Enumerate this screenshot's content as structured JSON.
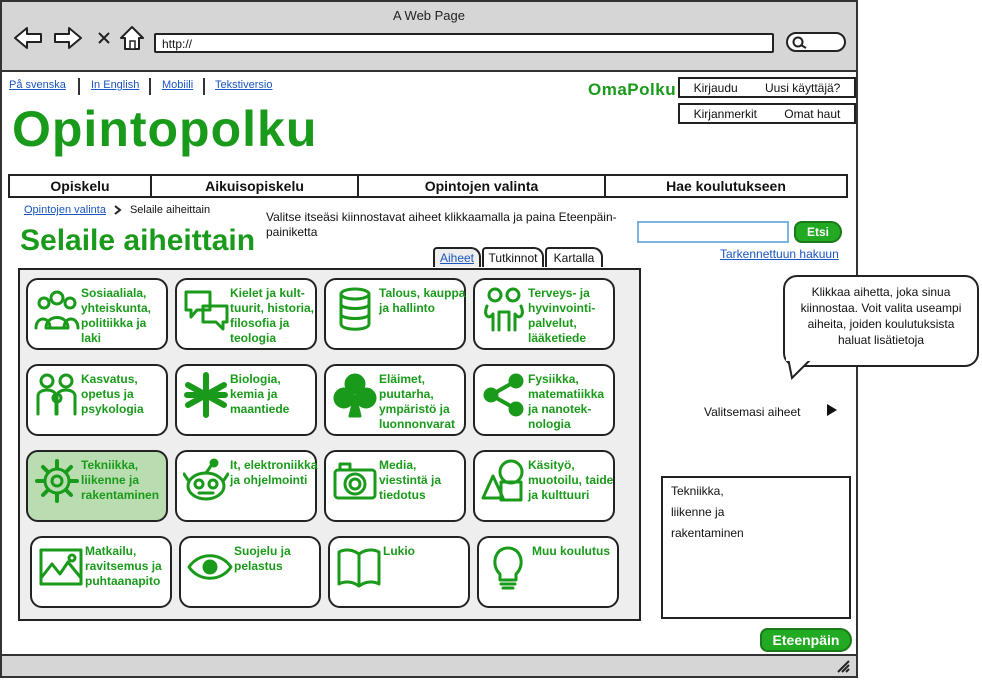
{
  "browser": {
    "window_title": "A Web Page",
    "url": "http://"
  },
  "top_links": [
    "På svenska",
    "In English",
    "Mobiili",
    "Tekstiversio"
  ],
  "header": {
    "brand": "OmaPolku",
    "logo": "Opintopolku",
    "login": "Kirjaudu",
    "new_user": "Uusi käyttäjä?",
    "bookmarks": "Kirjanmerkit",
    "my_searches": "Omat haut"
  },
  "main_nav": [
    "Opiskelu",
    "Aikuisopiskelu",
    "Opintojen valinta",
    "Hae koulutukseen"
  ],
  "breadcrumb": {
    "item1": "Opintojen valinta",
    "item2": "Selaile aiheittain"
  },
  "page": {
    "title": "Selaile aiheittain",
    "instructions": "Valitse itseäsi kiinnostavat aiheet klikkaamalla ja paina Eteenpäin-painiketta"
  },
  "search": {
    "button": "Etsi",
    "advanced": "Tarkennettuun hakuun"
  },
  "panel_tabs": [
    "Aiheet",
    "Tutkinnot",
    "Kartalla"
  ],
  "topics": [
    {
      "label": "Sosiaaliala, yhteiskunta, politiikka ja laki",
      "icon": "people-group-icon"
    },
    {
      "label": "Kielet ja kult-tuurit, historia, filosofia ja teologia",
      "icon": "speech-bubbles-icon"
    },
    {
      "label": "Talous, kauppa ja hallinto",
      "icon": "database-icon"
    },
    {
      "label": "Terveys- ja hyvinvointi-palvelut, lääketiede",
      "icon": "people-hugging-icon"
    },
    {
      "label": "Kasvatus, opetus ja psykologia",
      "icon": "family-icon"
    },
    {
      "label": "Biologia, kemia ja maantiede",
      "icon": "asterisk-icon"
    },
    {
      "label": "Eläimet, puutarha, ympäristö ja luonnonvarat",
      "icon": "club-icon"
    },
    {
      "label": "Fysiikka, matematiikka ja nanotek-nologia",
      "icon": "share-nodes-icon"
    },
    {
      "label": "Tekniikka, liikenne ja rakentaminen",
      "icon": "gear-icon"
    },
    {
      "label": "It, elektroniikka ja ohjelmointi",
      "icon": "robot-icon"
    },
    {
      "label": "Media, viestintä ja tiedotus",
      "icon": "camera-icon"
    },
    {
      "label": "Käsityö, muotoilu, taide ja kulttuuri",
      "icon": "shapes-icon"
    },
    {
      "label": "Matkailu, ravitsemus ja puhtaanapito",
      "icon": "landscape-image-icon"
    },
    {
      "label": "Suojelu ja pelastus",
      "icon": "eye-icon"
    },
    {
      "label": "Lukio",
      "icon": "open-book-icon"
    },
    {
      "label": "Muu koulutus",
      "icon": "lightbulb-icon"
    }
  ],
  "selected_topic_index": 8,
  "help_bubble": "Klikkaa aihetta, joka sinua kiinnostaa. Voit valita useampi aiheita, joiden koulutuksista haluat lisätietoja",
  "selected": {
    "label": "Valitsemasi aiheet",
    "items": [
      "Tekniikka,",
      "liikenne ja",
      "rakentaminen"
    ]
  },
  "next_button": "Eteenpäin",
  "colors": {
    "accent": "#1a9a1a",
    "button": "#22aa22",
    "selected_tile": "#b9ddb0",
    "link": "#1a55c0"
  }
}
